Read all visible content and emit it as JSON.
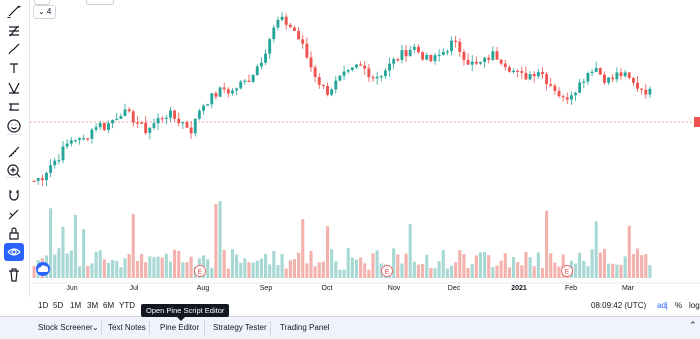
{
  "legend": {
    "collapse_label": "⌄ 4"
  },
  "toolbar": {
    "tools": [
      "trend-line-icon",
      "fib-retracement-icon",
      "brush-icon",
      "text-icon",
      "pattern-icon",
      "forecast-ruler-icon",
      "smiley-icon",
      "ruler-icon",
      "zoom-in-icon",
      "magnet-icon",
      "lock-drawing-icon",
      "lock-icon",
      "hide-drawings-icon",
      "trash-icon"
    ]
  },
  "chart_data": {
    "type": "candlestick",
    "x_labels": [
      "Jun",
      "Jul",
      "Aug",
      "Sep",
      "Oct",
      "Nov",
      "Dec",
      "2021",
      "Feb",
      "Mar"
    ],
    "event_marker": "E",
    "price_line_color": "#ef5350",
    "up_color": "#26a69a",
    "down_color": "#ef5350",
    "volume_up_color": "#a8d8d4",
    "volume_down_color": "#f3b2ad",
    "close_trend": [
      0.1,
      0.12,
      0.18,
      0.22,
      0.28,
      0.33,
      0.3,
      0.35,
      0.4,
      0.38,
      0.42,
      0.46,
      0.44,
      0.41,
      0.36,
      0.39,
      0.43,
      0.45,
      0.42,
      0.4,
      0.36,
      0.48,
      0.52,
      0.55,
      0.58,
      0.56,
      0.6,
      0.62,
      0.68,
      0.75,
      0.86,
      0.94,
      0.92,
      0.88,
      0.8,
      0.7,
      0.62,
      0.56,
      0.6,
      0.64,
      0.66,
      0.7,
      0.68,
      0.64,
      0.66,
      0.7,
      0.74,
      0.77,
      0.8,
      0.76,
      0.72,
      0.74,
      0.78,
      0.82,
      0.78,
      0.72,
      0.7,
      0.72,
      0.76,
      0.74,
      0.7,
      0.66,
      0.64,
      0.66,
      0.68,
      0.62,
      0.58,
      0.52,
      0.56,
      0.6,
      0.66,
      0.7,
      0.64,
      0.62,
      0.66,
      0.64,
      0.6,
      0.58,
      0.56
    ]
  },
  "ranges": [
    "1D",
    "5D",
    "1M",
    "3M",
    "6M",
    "YTD"
  ],
  "status": {
    "clock": "08:09:42 (UTC)",
    "adj": "adj",
    "percent": "%",
    "log": "log"
  },
  "tooltip": "Open Pine Script Editor",
  "bottom_tabs": {
    "stock_screener": "Stock Screener",
    "stock_screener_caret": "⌄",
    "text_notes": "Text Notes",
    "pine_editor": "Pine Editor",
    "strategy_tester": "Strategy Tester",
    "trading_panel": "Trading Panel",
    "collapse": "⌃"
  }
}
